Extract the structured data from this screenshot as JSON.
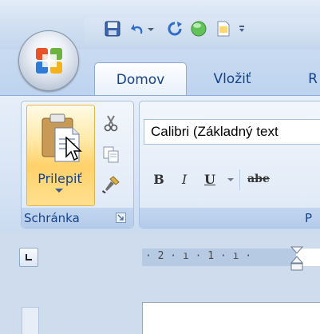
{
  "tabs": [
    {
      "label": "Domov",
      "active": true
    },
    {
      "label": "Vložiť",
      "active": false
    },
    {
      "label": "R",
      "active": false
    }
  ],
  "quick_access": {
    "icons": [
      "save-icon",
      "undo-icon",
      "dropdown-arrow-icon",
      "redo-icon",
      "circle-icon",
      "new-document-icon",
      "customize-icon"
    ]
  },
  "clipboard_group": {
    "paste_label": "Prilepiť",
    "group_label": "Schránka",
    "icons": [
      "paste-icon",
      "cut-icon",
      "copy-icon",
      "format-painter-icon",
      "dialog-launcher-icon"
    ]
  },
  "font_group": {
    "font_name": "Calibri (Základný text",
    "bold_label": "B",
    "italic_label": "I",
    "underline_label": "U",
    "strikethrough_label": "abe",
    "group_label": "P"
  },
  "ruler": {
    "text": "· 2 · ı · 1 · ı ·"
  },
  "colors": {
    "accent": "#15428b",
    "ribbon": "#dbe6f5",
    "paste_highlight": "#ffd26b"
  }
}
